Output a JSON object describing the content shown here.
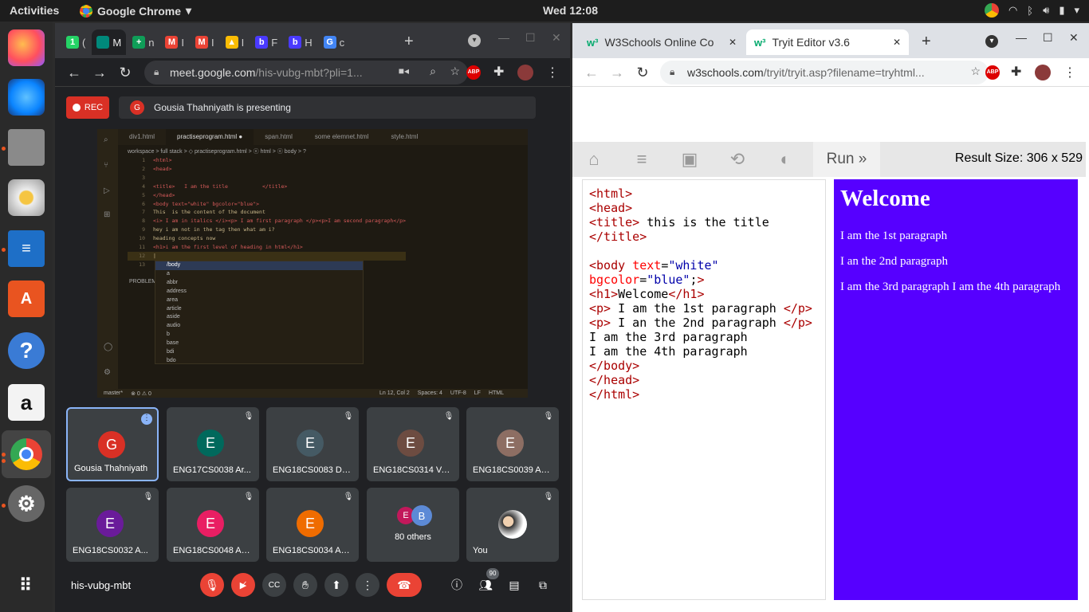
{
  "system": {
    "activities": "Activities",
    "app_name": "Google Chrome",
    "clock": "Wed 12:08"
  },
  "left_window": {
    "tabs": [
      {
        "label": "(",
        "fav": "1",
        "color": "#25d366"
      },
      {
        "label": "M",
        "fav": "",
        "color": "#00897b"
      },
      {
        "label": "n",
        "fav": "+",
        "color": "#0f9d58"
      },
      {
        "label": "I",
        "fav": "M",
        "color": "#ea4335"
      },
      {
        "label": "I",
        "fav": "M",
        "color": "#ea4335"
      },
      {
        "label": "I",
        "fav": "▲",
        "color": "#fbbc04"
      },
      {
        "label": "F",
        "fav": "b",
        "color": "#4a3aff"
      },
      {
        "label": "H",
        "fav": "b",
        "color": "#4a3aff"
      },
      {
        "label": "c",
        "fav": "G",
        "color": "#4285f4"
      }
    ],
    "url_domain": "meet.google.com",
    "url_rest": "/his-vubg-mbt?pli=1...",
    "rec_label": "REC",
    "presenter_initial": "G",
    "presenting_text": "Gousia Thahniyath is presenting",
    "vscode": {
      "tabs": [
        "div1.html",
        "practiseprogram.html ●",
        "span.html",
        "some elemnet.html",
        "style.html"
      ],
      "breadcrumb": "workspace > full stack > ◇ practiseprogram.html > ⓔ html > ⓔ body > ?",
      "lines": [
        {
          "n": "1",
          "code": "<html>"
        },
        {
          "n": "2",
          "code": "<head>"
        },
        {
          "n": "3",
          "code": ""
        },
        {
          "n": "4",
          "code": "<title>   I am the title           </title>"
        },
        {
          "n": "5",
          "code": "</head>"
        },
        {
          "n": "6",
          "code": "<body text=\"white\" bgcolor=\"blue\">"
        },
        {
          "n": "7",
          "code": "This  is the content of the document"
        },
        {
          "n": "8",
          "code": "<i> I am in italics </i><p> I am first paragraph </p><p>I am second paragraph</p>"
        },
        {
          "n": "9",
          "code": "hey i am not in the tag then what am i?"
        },
        {
          "n": "10",
          "code": "heading concepts now"
        },
        {
          "n": "11",
          "code": "<h1>i am the first level of heading in html</h1>"
        },
        {
          "n": "12",
          "code": "|"
        },
        {
          "n": "13",
          "code": ""
        }
      ],
      "problems": "PROBLEM",
      "autocomplete": [
        "/body",
        "a",
        "abbr",
        "address",
        "area",
        "article",
        "aside",
        "audio",
        "b",
        "base",
        "bdi",
        "bdo"
      ],
      "status": {
        "branch": "master*",
        "errors": "⊗ 0 ⚠ 0",
        "pos": "Ln 12, Col 2",
        "spaces": "Spaces: 4",
        "enc": "UTF-8",
        "eol": "LF",
        "lang": "HTML"
      }
    },
    "participants": [
      {
        "name": "Gousia Thahniyath",
        "initial": "G",
        "color": "#d93025",
        "speaking": true
      },
      {
        "name": "ENG17CS0038 Ar...",
        "initial": "E",
        "color": "#00695c"
      },
      {
        "name": "ENG18CS0083 DE...",
        "initial": "E",
        "color": "#455a64"
      },
      {
        "name": "ENG18CS0314 VA...",
        "initial": "E",
        "color": "#6d4c41"
      },
      {
        "name": "ENG18CS0039 An...",
        "initial": "E",
        "color": "#8d6e63"
      },
      {
        "name": "ENG18CS0032 A...",
        "initial": "E",
        "color": "#6a1b9a"
      },
      {
        "name": "ENG18CS0048 As...",
        "initial": "E",
        "color": "#e91e63"
      },
      {
        "name": "ENG18CS0034 An...",
        "initial": "E",
        "color": "#ef6c00"
      }
    ],
    "others_label": "80 others",
    "others_initials": [
      "E",
      "B"
    ],
    "you_label": "You",
    "meeting_code": "his-vubg-mbt",
    "participant_count": "90"
  },
  "right_window": {
    "tabs": [
      {
        "label": "W3Schools Online Co"
      },
      {
        "label": "Tryit Editor v3.6"
      }
    ],
    "url_domain": "w3schools.com",
    "url_rest": "/tryit/tryit.asp?filename=tryhtml...",
    "run_label": "Run »",
    "result_size": "Result Size: 306 x 529",
    "result": {
      "heading": "Welcome",
      "p1": "I am the 1st paragraph",
      "p2": "I an the 2nd paragraph",
      "p3": "I am the 3rd paragraph I am the 4th paragraph"
    }
  },
  "colors": {
    "result_bg": "#5600ff",
    "meet_bg": "#202124",
    "end_call": "#ea4335"
  }
}
